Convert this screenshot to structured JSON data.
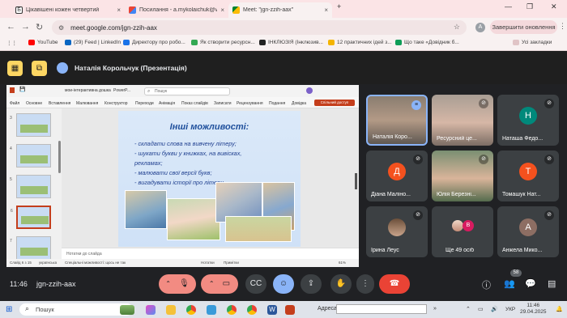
{
  "browser": {
    "tabs": [
      {
        "label": "Цікавішені кожен четвертий",
        "icon": "b-icon"
      },
      {
        "label": "Посилання - a.mykolaichuk@vipp",
        "icon": "gmail-icon"
      },
      {
        "label": "Meet: \"jgn-zzih-aax\"",
        "icon": "meet-icon"
      }
    ],
    "url": "meet.google.com/jgn-zzih-aax",
    "profile_initial": "A",
    "update_label": "Завершити оновлення",
    "bookmarks": [
      {
        "label": "YouTube",
        "color": "#ff0000"
      },
      {
        "label": "(29) Feed | LinkedIn",
        "color": "#0a66c2"
      },
      {
        "label": "Директору про робо...",
        "color": "#1a73e8"
      },
      {
        "label": "Як створити ресурсн...",
        "color": "#34a853"
      },
      {
        "label": "ІНКЛЮЗІЯ (Інклюзив...",
        "color": "#222222"
      },
      {
        "label": "12 практичних ідей з...",
        "color": "#f4b400"
      },
      {
        "label": "Що таке «Довідник б...",
        "color": "#0f9d58"
      }
    ],
    "all_bookmarks": "Усі закладки"
  },
  "meet": {
    "presenter_title": "Наталія Корольчук (Презентація)",
    "time": "11:46",
    "code": "jgn-zzih-aax",
    "participants_badge": "58",
    "tiles": [
      {
        "name": "Наталія Коро...",
        "type": "photo",
        "active": true
      },
      {
        "name": "Ресурсний це...",
        "type": "photo"
      },
      {
        "name": "Наташа Федо...",
        "initial": "Н",
        "color": "#00897b"
      },
      {
        "name": "Діана Маліно...",
        "initial": "Д",
        "color": "#f4511e"
      },
      {
        "name": "Юлія Березні...",
        "type": "photo"
      },
      {
        "name": "Томашук Нат...",
        "initial": "Т",
        "color": "#f4511e"
      },
      {
        "name": "Ірина Леус",
        "type": "photo"
      },
      {
        "name": "Ще 49 осіб",
        "initial": "В",
        "color": "#d81b60"
      },
      {
        "name": "Анжела Мико...",
        "initial": "А",
        "color": "#8d6e63"
      }
    ]
  },
  "ppt": {
    "doc_name": "мои-інтерактивна дошка",
    "app_name": "PowerP...",
    "search_placeholder": "Пошук",
    "ribbon": [
      "Файл",
      "Основне",
      "Вставлення",
      "Малювання",
      "Конструктор",
      "Переходи",
      "Анімація",
      "Показ слайдів",
      "Записати",
      "Рецензування",
      "Подання",
      "Довідка"
    ],
    "share_label": "Спільний доступ",
    "slide_title": "Інші можливості:",
    "slide_lines": [
      "- складати слова на вивчену літеру;",
      "- шукати букви у книжках, на вивісках,",
      "   рекламах;",
      "- малювати свої версії букв;",
      "- вигадувати історії про літери."
    ],
    "notes_placeholder": "Нотатки до слайда",
    "status_slide": "Слайд 6 з 15",
    "status_lang": "українська",
    "status_access": "Спеціальні можливості: щось не так",
    "status_notes": "Нотатки",
    "status_comments": "Примітки",
    "zoom": "61%",
    "thumb_numbers": [
      "3",
      "4",
      "5",
      "6",
      "7"
    ]
  },
  "taskbar": {
    "search_placeholder": "Пошук",
    "address_label": "Адреса",
    "lang": "УКР",
    "time": "11:46",
    "date": "29.04.2025"
  }
}
